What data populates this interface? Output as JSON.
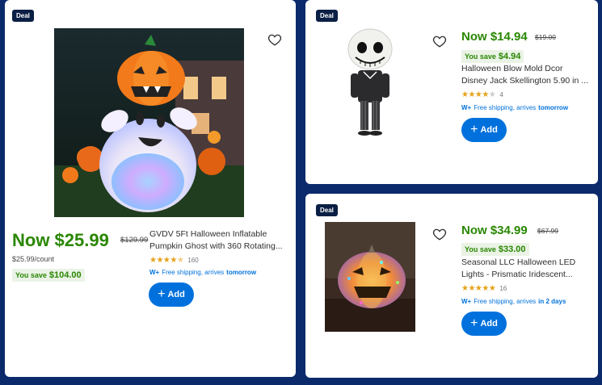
{
  "colors": {
    "page_bg": "#0b2a6b",
    "price_green": "#2a8703",
    "save_bg": "#eaf3e6",
    "button_blue": "#0071dc",
    "deal_bg": "#0a1f44",
    "star": "#e6a117"
  },
  "products": [
    {
      "badge": "Deal",
      "price_now": "Now $25.99",
      "price_was": "$129.99",
      "unit_price": "$25.99/count",
      "you_save_label": "You save",
      "you_save_amount": "$104.00",
      "title_line1": "GVDV 5Ft Halloween Inflatable",
      "title_line2": "Pumpkin Ghost with 360 Rotating...",
      "rating_stars": 4.5,
      "review_count": "160",
      "shipping_prefix": "W+",
      "shipping_text": "Free shipping, arrives",
      "shipping_when": "tomorrow",
      "add_label": "Add",
      "image_icon": "inflatable-pumpkin-ghost-image"
    },
    {
      "badge": "Deal",
      "price_now": "Now $14.94",
      "price_was": "$19.00",
      "you_save_label": "You save",
      "you_save_amount": "$4.94",
      "title_line1": "Halloween Blow Mold Dcor",
      "title_line2": "Disney Jack Skellington 5.90 in ...",
      "rating_stars": 4,
      "review_count": "4",
      "shipping_prefix": "W+",
      "shipping_text": "Free shipping, arrives",
      "shipping_when": "tomorrow",
      "add_label": "Add",
      "image_icon": "jack-skellington-image"
    },
    {
      "badge": "Deal",
      "price_now": "Now $34.99",
      "price_was": "$67.99",
      "you_save_label": "You save",
      "you_save_amount": "$33.00",
      "title_line1": "Seasonal LLC Halloween LED",
      "title_line2": "Lights - Prismatic Iridescent...",
      "rating_stars": 5,
      "review_count": "16",
      "shipping_prefix": "W+",
      "shipping_text": "Free shipping, arrives",
      "shipping_when": "in 2 days",
      "add_label": "Add",
      "image_icon": "iridescent-pumpkin-image"
    }
  ]
}
